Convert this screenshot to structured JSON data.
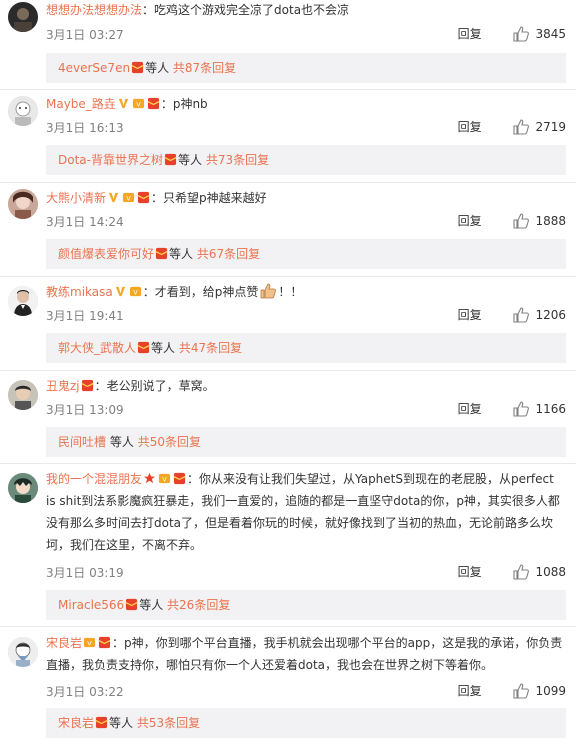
{
  "comments": [
    {
      "user": "想想办法想想办法",
      "sep": "：",
      "text": "吃鸡这个游戏完全凉了dota也不会凉",
      "badges": [],
      "date": "3月1日 03:27",
      "reply_label": "回复",
      "likes": "3845",
      "sub_user": "4everSe7en",
      "sub_etc": "等人",
      "sub_more": "共87条回复"
    },
    {
      "user": "Maybe_路垚",
      "sep": "：",
      "text": "p神nb",
      "badges": [
        "v-badge",
        "vip-badge",
        "redpacket-badge"
      ],
      "date": "3月1日 16:13",
      "reply_label": "回复",
      "likes": "2719",
      "sub_user": "Dota-背靠世界之树",
      "sub_etc": "等人",
      "sub_more": "共73条回复"
    },
    {
      "user": "大熊小清新",
      "sep": "：",
      "text": "只希望p神越来越好",
      "badges": [
        "v-badge",
        "vip-badge",
        "redpacket-badge"
      ],
      "date": "3月1日 14:24",
      "reply_label": "回复",
      "likes": "1888",
      "sub_user": "颜值爆表爱你可好",
      "sub_etc": "等人",
      "sub_more": "共67条回复"
    },
    {
      "user": "教练mikasa",
      "sep": "：",
      "text": "才看到，给p神点赞",
      "text_tail": "！！",
      "badges": [
        "v-badge",
        "vip-badge"
      ],
      "date": "3月1日 19:41",
      "reply_label": "回复",
      "likes": "1206",
      "sub_user": "郭大侠_武散人",
      "sub_etc": "等人",
      "sub_more": "共47条回复"
    },
    {
      "user": "丑鬼zj",
      "sep": "：",
      "text": "老公别说了，草窝。",
      "badges": [
        "redpacket-badge"
      ],
      "date": "3月1日 13:09",
      "reply_label": "回复",
      "likes": "1166",
      "sub_user": "民间吐槽",
      "sub_etc": "等人",
      "sub_more": "共50条回复"
    },
    {
      "user": "我的一个混混朋友",
      "sep": "：",
      "text": "你从来没有让我们失望过，从YaphetS到现在的老屁股，从perfect is shit到法系影魔疯狂暴走，我们一直爱的，追随的都是一直坚守dota的你，p神，其实很多人都没有那么多时间去打dota了，但是看着你玩的时候，就好像找到了当初的热血，无论前路多么坎坷，我们在这里，不离不弃。",
      "badges": [
        "star-badge",
        "vip-badge",
        "redpacket-badge"
      ],
      "date": "3月1日 03:19",
      "reply_label": "回复",
      "likes": "1088",
      "sub_user": "Miracle566",
      "sub_etc": "等人",
      "sub_more": "共26条回复"
    },
    {
      "user": "宋良岩",
      "sep": "：",
      "text": "p神，你到哪个平台直播，我手机就会出现哪个平台的app，这是我的承诺，你负责直播，我负责支持你，哪怕只有你一个人还爱着dota，我也会在世界之树下等着你。",
      "badges": [
        "vip-badge",
        "redpacket-badge"
      ],
      "date": "3月1日 03:22",
      "reply_label": "回复",
      "likes": "1099",
      "sub_user": "宋良岩",
      "sub_etc": "等人",
      "sub_more": "共53条回复"
    }
  ],
  "colors": {
    "username": "#eb7350",
    "meta": "#808080",
    "sub_bg": "#f2f2f5"
  }
}
